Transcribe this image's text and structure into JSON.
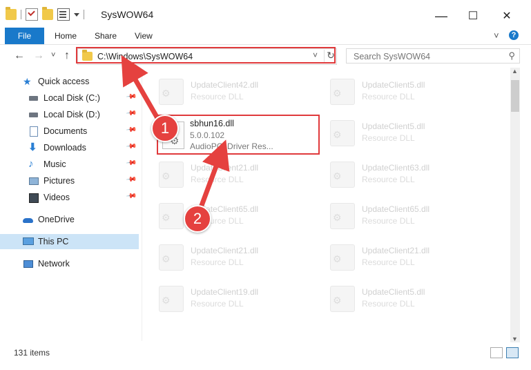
{
  "window": {
    "title": "SysWOW64",
    "minimize": "—",
    "maximize": "☐",
    "close": "✕"
  },
  "ribbon": {
    "tabs": [
      "File",
      "Home",
      "Share",
      "View"
    ],
    "collapse": "˅",
    "help": "?"
  },
  "address": {
    "path": "C:\\Windows\\SysWOW64",
    "dropdown": "˅",
    "refresh": "↻"
  },
  "search": {
    "placeholder": "Search SysWOW64"
  },
  "nav": {
    "back": "←",
    "forward": "→",
    "recent": "˅",
    "up": "↑"
  },
  "sidebar": {
    "items": [
      {
        "label": "Quick access",
        "icon": "star-icon"
      },
      {
        "label": "Local Disk (C:)",
        "icon": "drive-icon",
        "pinned": true
      },
      {
        "label": "Local Disk (D:)",
        "icon": "drive-icon",
        "pinned": true
      },
      {
        "label": "Documents",
        "icon": "documents-icon",
        "pinned": true
      },
      {
        "label": "Downloads",
        "icon": "download-icon",
        "pinned": true
      },
      {
        "label": "Music",
        "icon": "music-icon",
        "pinned": true
      },
      {
        "label": "Pictures",
        "icon": "pictures-icon",
        "pinned": true
      },
      {
        "label": "Videos",
        "icon": "videos-icon",
        "pinned": true
      },
      {
        "label": "OneDrive",
        "icon": "cloud-icon"
      },
      {
        "label": "This PC",
        "icon": "computer-icon",
        "selected": true
      },
      {
        "label": "Network",
        "icon": "network-icon"
      }
    ]
  },
  "files": {
    "left": [
      {
        "name": "UpdateClient42.dll",
        "desc": "Resource DLL"
      },
      {
        "name": "",
        "desc": ""
      },
      {
        "name": "UpdateClient21.dll",
        "desc": "Resource DLL"
      },
      {
        "name": "UpdateClient65.dll",
        "desc": "Resource DLL"
      },
      {
        "name": "UpdateClient21.dll",
        "desc": "Resource DLL"
      },
      {
        "name": "UpdateClient19.dll",
        "desc": "Resource DLL"
      }
    ],
    "right": [
      {
        "name": "UpdateClient5.dll",
        "desc": "Resource DLL"
      },
      {
        "name": "UpdateClient5.dll",
        "desc": "Resource DLL"
      },
      {
        "name": "UpdateClient63.dll",
        "desc": "Resource DLL"
      },
      {
        "name": "UpdateClient65.dll",
        "desc": "Resource DLL"
      },
      {
        "name": "UpdateClient21.dll",
        "desc": "Resource DLL"
      },
      {
        "name": "UpdateClient5.dll",
        "desc": "Resource DLL"
      }
    ],
    "selected": {
      "name": "sbhun16.dll",
      "version": "5.0.0.102",
      "desc": "AudioPCI Driver Res..."
    }
  },
  "status": {
    "count": "131 items"
  },
  "annotations": {
    "step1": "1",
    "step2": "2",
    "color": "#e5413f"
  }
}
